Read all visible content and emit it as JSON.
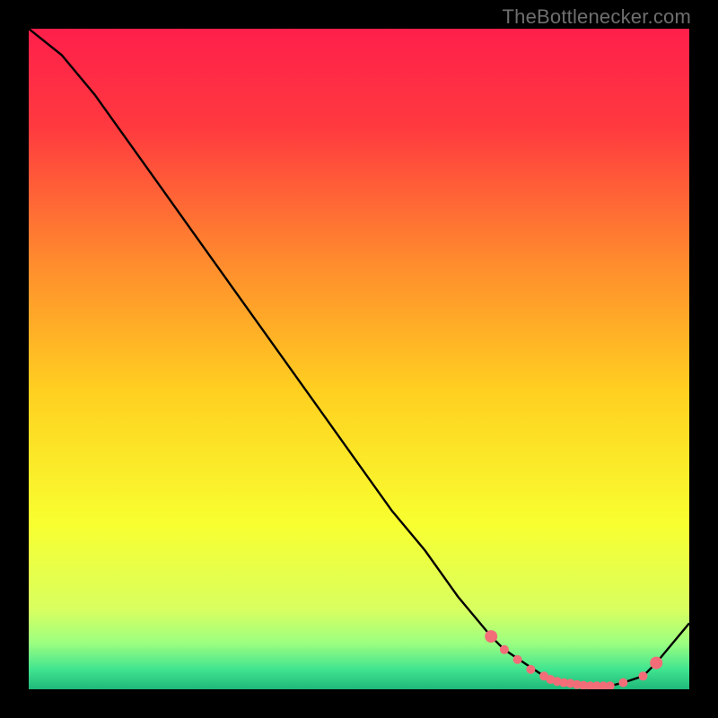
{
  "attribution": "TheBottlenecker.com",
  "chart_data": {
    "type": "line",
    "x": [
      0.0,
      0.05,
      0.1,
      0.15,
      0.2,
      0.25,
      0.3,
      0.35,
      0.4,
      0.45,
      0.5,
      0.55,
      0.6,
      0.65,
      0.7,
      0.72,
      0.75,
      0.78,
      0.8,
      0.83,
      0.85,
      0.88,
      0.9,
      0.93,
      0.95,
      1.0
    ],
    "values": [
      100,
      96,
      90,
      83,
      76,
      69,
      62,
      55,
      48,
      41,
      34,
      27,
      21,
      14,
      8,
      6,
      4,
      2,
      1,
      0.5,
      0.5,
      0.5,
      1,
      2,
      4,
      10
    ],
    "markers_x": [
      0.7,
      0.72,
      0.74,
      0.76,
      0.78,
      0.79,
      0.8,
      0.81,
      0.82,
      0.83,
      0.84,
      0.85,
      0.86,
      0.87,
      0.88,
      0.9,
      0.93,
      0.95
    ],
    "markers_y": [
      8,
      6,
      4.5,
      3,
      2,
      1.5,
      1.2,
      1,
      0.9,
      0.7,
      0.6,
      0.5,
      0.5,
      0.5,
      0.5,
      1,
      2,
      4
    ],
    "title": "",
    "xlabel": "",
    "ylabel": "",
    "xlim": [
      0,
      1
    ],
    "ylim": [
      0,
      100
    ],
    "gradient_stops": [
      {
        "offset": 0.0,
        "color": "#ff1f4b"
      },
      {
        "offset": 0.15,
        "color": "#ff3a3f"
      },
      {
        "offset": 0.35,
        "color": "#ff8a2e"
      },
      {
        "offset": 0.55,
        "color": "#ffd020"
      },
      {
        "offset": 0.75,
        "color": "#f8ff30"
      },
      {
        "offset": 0.88,
        "color": "#d8ff60"
      },
      {
        "offset": 0.93,
        "color": "#9cff80"
      },
      {
        "offset": 0.97,
        "color": "#40e490"
      },
      {
        "offset": 1.0,
        "color": "#1fb87a"
      }
    ],
    "marker_color": "#f26d78",
    "marker_radius_small": 5,
    "marker_radius_large": 7
  }
}
